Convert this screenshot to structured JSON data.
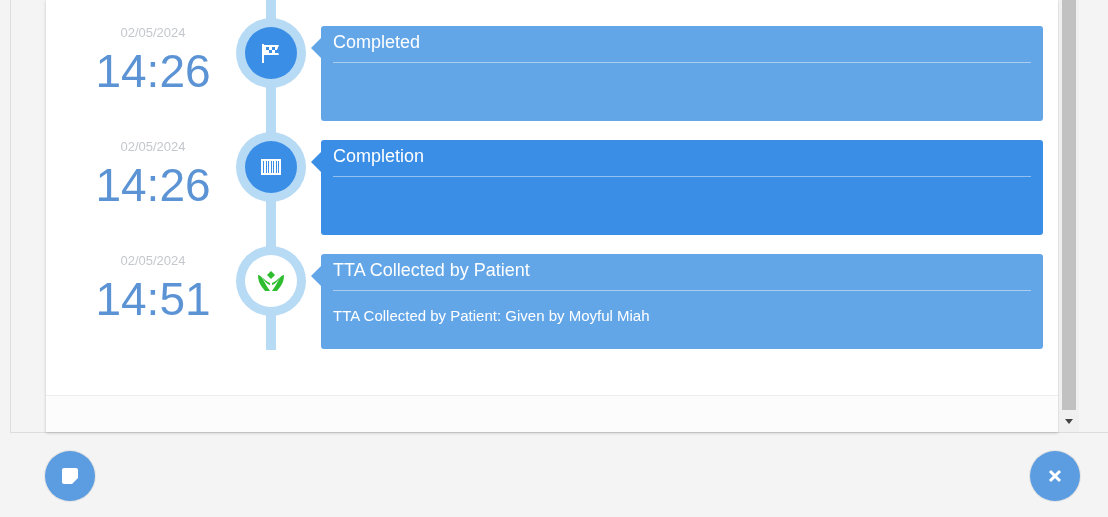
{
  "timeline": [
    {
      "date": "02/05/2024",
      "time": "14:26",
      "kind": "flag",
      "title": "Completed",
      "highlighted": false
    },
    {
      "date": "02/05/2024",
      "time": "14:26",
      "kind": "barcode",
      "title": "Completion",
      "highlighted": true
    },
    {
      "date": "02/05/2024",
      "time": "14:51",
      "kind": "hands",
      "title": "TTA Collected by Patient",
      "detail": "TTA Collected by Patient: Given by Moyful Miah",
      "highlighted": false
    }
  ]
}
